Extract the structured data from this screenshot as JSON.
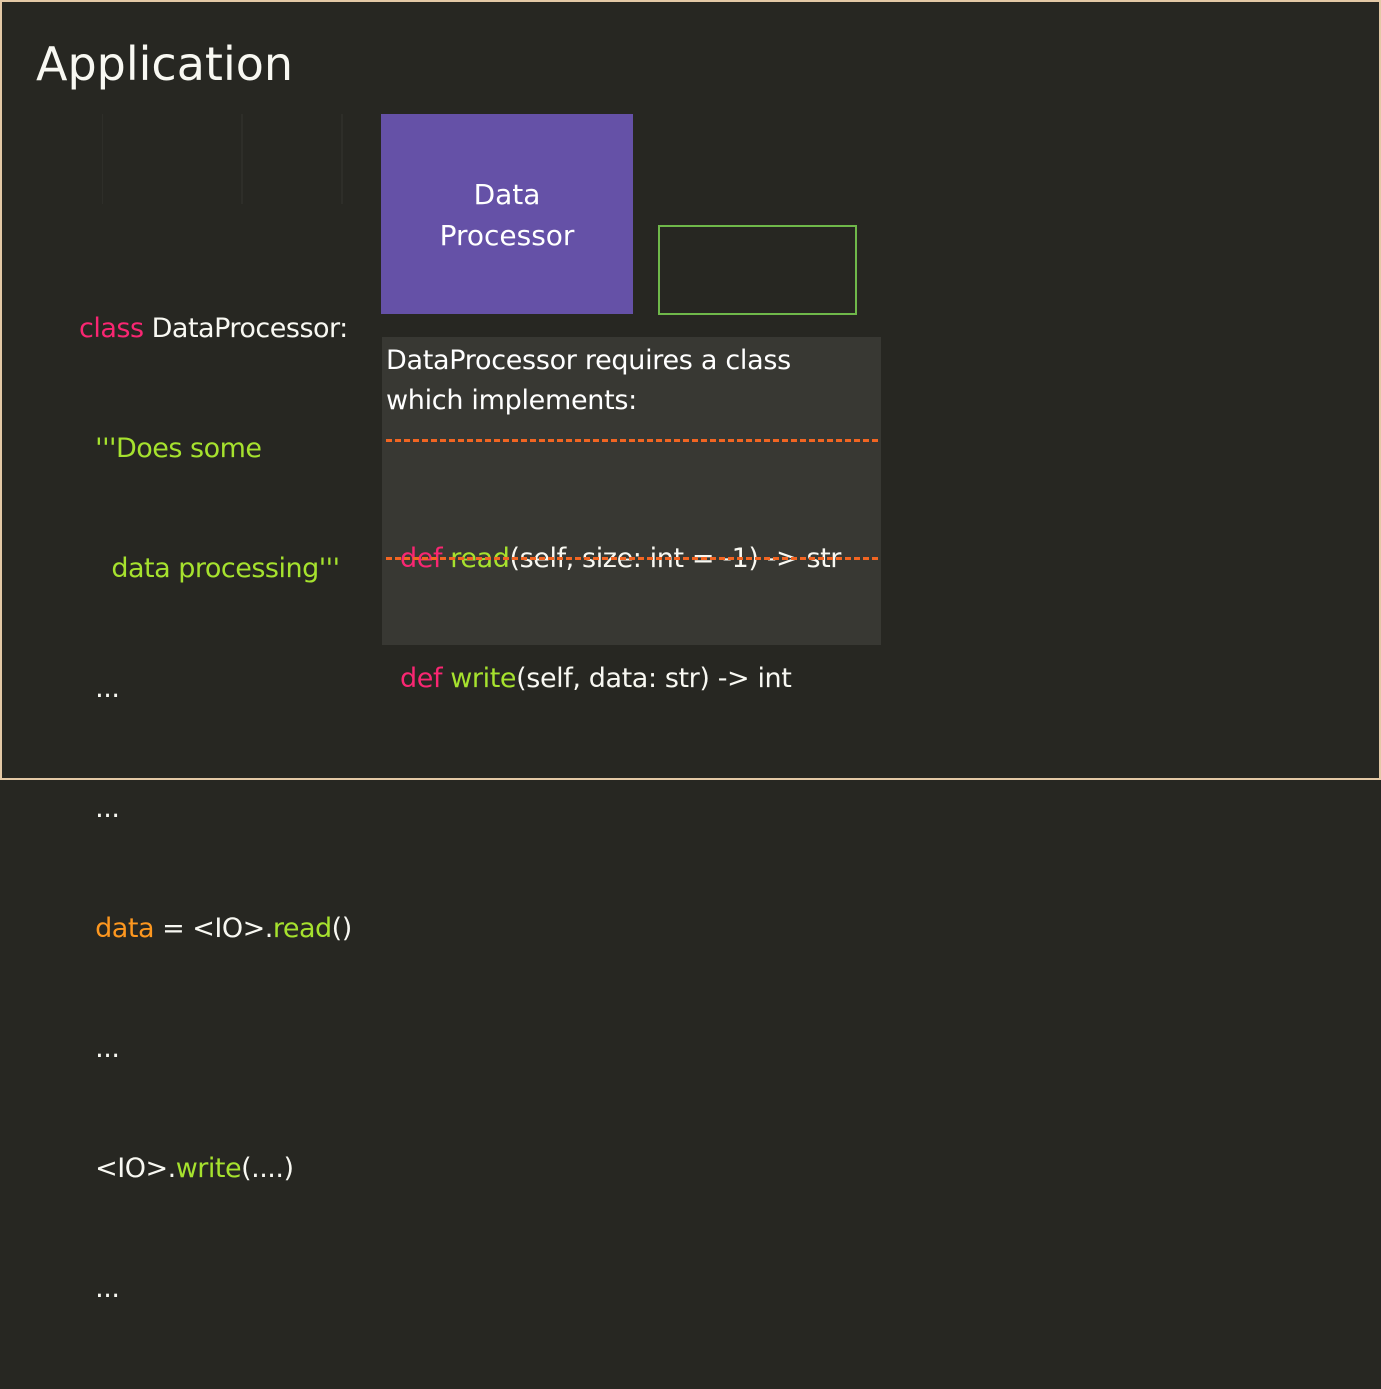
{
  "title": "Application",
  "code": {
    "line1": {
      "kw": "class",
      "name": " DataProcessor:"
    },
    "line2": {
      "indent": "  ",
      "doc": "'''Does some"
    },
    "line3": {
      "indent": "    ",
      "doc": "data processing'''"
    },
    "line4": {
      "indent": "  ",
      "text": "..."
    },
    "line5": {
      "indent": "  ",
      "text": "..."
    },
    "line6": {
      "indent": "  ",
      "var": "data",
      "mid": " = <IO>.",
      "fn": "read",
      "end": "()"
    },
    "line7": {
      "indent": "  ",
      "text": "..."
    },
    "line8": {
      "indent": "  ",
      "pre": "<IO>.",
      "fn": "write",
      "end": "(....)"
    },
    "line9": {
      "indent": "  ",
      "text": "..."
    }
  },
  "processor_box": {
    "line1": "Data",
    "line2": "Processor"
  },
  "requirements": {
    "line1": "DataProcessor requires a class",
    "line2": "which implements:",
    "methods": [
      {
        "kw": "def",
        "name": "read",
        "sig": "(self, size: int = -1) -> str"
      },
      {
        "kw": "def",
        "name": "write",
        "sig": "(self, data: str) -> int"
      }
    ]
  },
  "colors": {
    "background": "#272722",
    "keyword": "#f92672",
    "string": "#a6e22e",
    "variable": "#fd971f",
    "processor_box": "#6551a7",
    "slot_border": "#6fb84a",
    "dash": "#f26522"
  }
}
